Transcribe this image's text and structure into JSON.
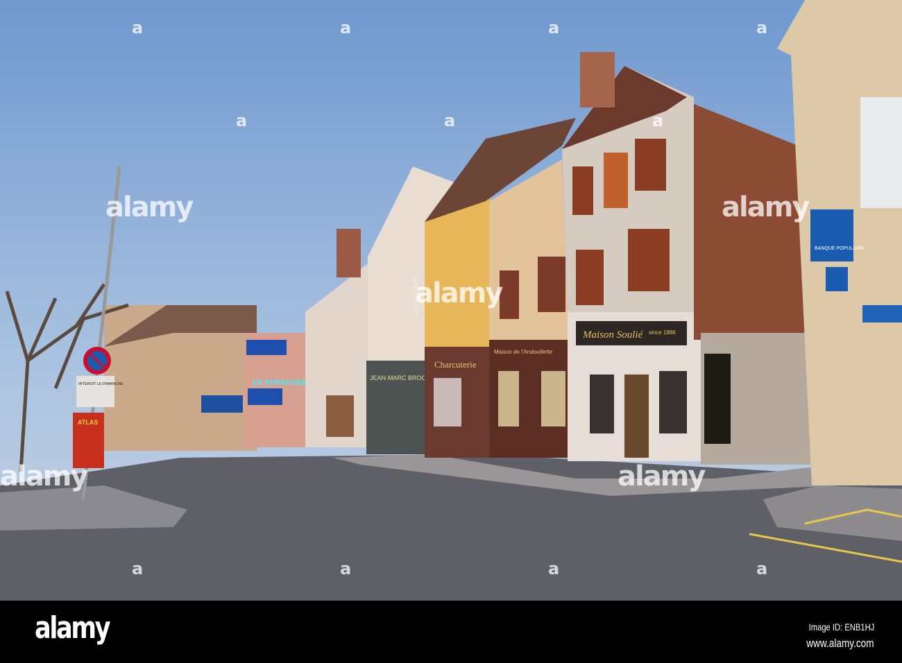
{
  "photo": {
    "description_signs": {
      "shop_maison_soulie": "Maison Soulié",
      "shop_maison_soulie_since": "since 1886",
      "shop_charcuterie": "Charcuterie",
      "shop_andouillette": "Maison de l'Andouillette",
      "shop_syracuse": "LE SYRACUSE",
      "shop_brocard": "JEAN-MARC BROCARD",
      "vertical_brocard": "BROCARD",
      "bank": "BANQUE POPULAIRE",
      "road_sign": "INTERDIT LE DIMANCHE",
      "poster": "ATLAS"
    },
    "colors": {
      "sky": "#8fb0d8",
      "road": "#5f6068",
      "bank_sign": "#1a5cb0",
      "neon": "#3ff0ff"
    }
  },
  "watermark": {
    "small": "a",
    "big": "alamy"
  },
  "footer": {
    "logo": "alamy",
    "image_id": "Image ID: ENB1HJ",
    "website": "www.alamy.com"
  }
}
